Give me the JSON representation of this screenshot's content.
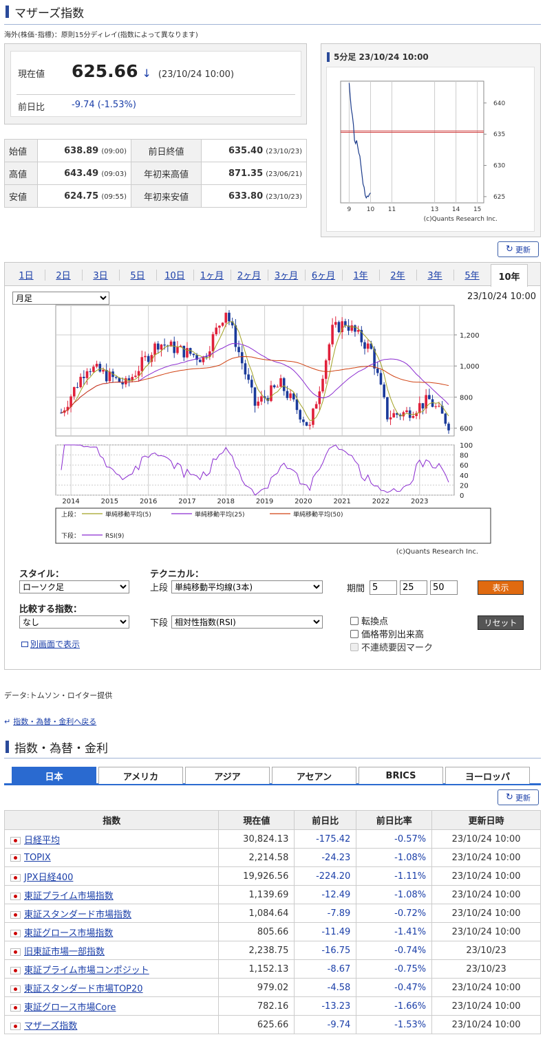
{
  "page": {
    "title": "マザーズ指数",
    "note": "海外(株価･指標)：原則15分ディレイ(指数によって異なります)"
  },
  "quote": {
    "current_label": "現在値",
    "current_value": "625.66",
    "arrow": "↓",
    "current_date": "(23/10/24 10:00)",
    "change_label": "前日比",
    "change_value": "-9.74 (-1.53%)"
  },
  "ohlc": {
    "rows": [
      {
        "l1": "始値",
        "v1": "638.89",
        "t1": "(09:00)",
        "l2": "前日終値",
        "v2": "635.40",
        "t2": "(23/10/23)"
      },
      {
        "l1": "高値",
        "v1": "643.49",
        "t1": "(09:03)",
        "l2": "年初来高値",
        "v2": "871.35",
        "t2": "(23/06/21)"
      },
      {
        "l1": "安値",
        "v1": "624.75",
        "t1": "(09:55)",
        "l2": "年初来安値",
        "v2": "633.80",
        "t2": "(23/10/23)"
      }
    ]
  },
  "mini_chart": {
    "title": "5分足 23/10/24 10:00",
    "y_ticks": [
      "640",
      "635",
      "630",
      "625"
    ],
    "x_ticks": [
      "9",
      "10",
      "11",
      "13",
      "14",
      "15"
    ],
    "credit": "(c)Quants Research Inc.",
    "ref_line": 635.4,
    "line_color": "#1a3a8a",
    "ref_color": "#d04040"
  },
  "refresh_label": "更新",
  "chart_tabs": [
    "1日",
    "2日",
    "3日",
    "5日",
    "10日",
    "1ヶ月",
    "2ヶ月",
    "3ヶ月",
    "6ヶ月",
    "1年",
    "2年",
    "3年",
    "5年",
    "10年"
  ],
  "active_tab": "10年",
  "period_select": "月足",
  "chart_date": "23/10/24 10:00",
  "main_chart": {
    "y_ticks": [
      "1,200",
      "1,000",
      "800",
      "600"
    ],
    "rsi_ticks": [
      "100",
      "80",
      "60",
      "40",
      "20",
      "0"
    ],
    "x_ticks": [
      "2014",
      "2015",
      "2016",
      "2017",
      "2018",
      "2019",
      "2020",
      "2021",
      "2022",
      "2023"
    ],
    "legend_upper_label": "上段：",
    "legend_lower_label": "下段：",
    "legend": [
      {
        "name": "単純移動平均(5)",
        "color": "#a0a020"
      },
      {
        "name": "単純移動平均(25)",
        "color": "#8a2ad0"
      },
      {
        "name": "単純移動平均(50)",
        "color": "#d04010"
      },
      {
        "name": "RSI(9)",
        "color": "#8a2ad0"
      }
    ],
    "credit": "(c)Quants Research Inc.",
    "up_color": "#e0203a",
    "down_color": "#1a3a9a"
  },
  "chart_data": {
    "type": "line",
    "title": "",
    "x": [
      "2013-10",
      "2014-06",
      "2015-06",
      "2016-04",
      "2017-06",
      "2018-01",
      "2018-10",
      "2019-06",
      "2020-03",
      "2020-10",
      "2021-02",
      "2021-10",
      "2022-03",
      "2022-09",
      "2023-04",
      "2023-10"
    ],
    "series": [
      {
        "values": [
          700,
          1000,
          880,
          1150,
          1050,
          1360,
          750,
          880,
          600,
          1230,
          1280,
          1100,
          680,
          700,
          780,
          626
        ]
      }
    ],
    "ylim": [
      550,
      1390
    ],
    "rsi_ylim": [
      0,
      100
    ]
  },
  "controls": {
    "style_label": "スタイル：",
    "style_value": "ローソク足",
    "technical_label": "テクニカル：",
    "upper_label": "上段",
    "upper_value": "単純移動平均線(3本)",
    "period_label": "期間",
    "period_values": [
      "5",
      "25",
      "50"
    ],
    "show_button": "表示",
    "compare_label": "比較する指数：",
    "compare_value": "なし",
    "lower_label": "下段",
    "lower_value": "相対性指数(RSI)",
    "reset_button": "リセット",
    "checkboxes": [
      "転換点",
      "価格帯別出来高",
      "不連続要因マーク"
    ],
    "separate_window": "別画面で表示"
  },
  "data_source": "データ:トムソン・ロイター提供",
  "back_link": "指数・為替・金利へ戻る",
  "section2_title": "指数・為替・金利",
  "region_tabs": [
    "日本",
    "アメリカ",
    "アジア",
    "アセアン",
    "BRICS",
    "ヨーロッパ"
  ],
  "table": {
    "headers": [
      "指数",
      "現在値",
      "前日比",
      "前日比率",
      "更新日時"
    ],
    "rows": [
      {
        "name": "日経平均",
        "value": "30,824.13",
        "chg": "-175.42",
        "pct": "-0.57%",
        "date": "23/10/24 10:00"
      },
      {
        "name": "TOPIX",
        "value": "2,214.58",
        "chg": "-24.23",
        "pct": "-1.08%",
        "date": "23/10/24 10:00"
      },
      {
        "name": "JPX日経400",
        "value": "19,926.56",
        "chg": "-224.20",
        "pct": "-1.11%",
        "date": "23/10/24 10:00"
      },
      {
        "name": "東証プライム市場指数",
        "value": "1,139.69",
        "chg": "-12.49",
        "pct": "-1.08%",
        "date": "23/10/24 10:00"
      },
      {
        "name": "東証スタンダード市場指数",
        "value": "1,084.64",
        "chg": "-7.89",
        "pct": "-0.72%",
        "date": "23/10/24 10:00"
      },
      {
        "name": "東証グロース市場指数",
        "value": "805.66",
        "chg": "-11.49",
        "pct": "-1.41%",
        "date": "23/10/24 10:00"
      },
      {
        "name": "旧東証市場一部指数",
        "value": "2,238.75",
        "chg": "-16.75",
        "pct": "-0.74%",
        "date": "23/10/23"
      },
      {
        "name": "東証プライム市場コンポジット",
        "value": "1,152.13",
        "chg": "-8.67",
        "pct": "-0.75%",
        "date": "23/10/23"
      },
      {
        "name": "東証スタンダード市場TOP20",
        "value": "979.02",
        "chg": "-4.58",
        "pct": "-0.47%",
        "date": "23/10/24 10:00"
      },
      {
        "name": "東証グロース市場Core",
        "value": "782.16",
        "chg": "-13.23",
        "pct": "-1.66%",
        "date": "23/10/24 10:00"
      },
      {
        "name": "マザーズ指数",
        "value": "625.66",
        "chg": "-9.74",
        "pct": "-1.53%",
        "date": "23/10/24 10:00"
      }
    ]
  }
}
